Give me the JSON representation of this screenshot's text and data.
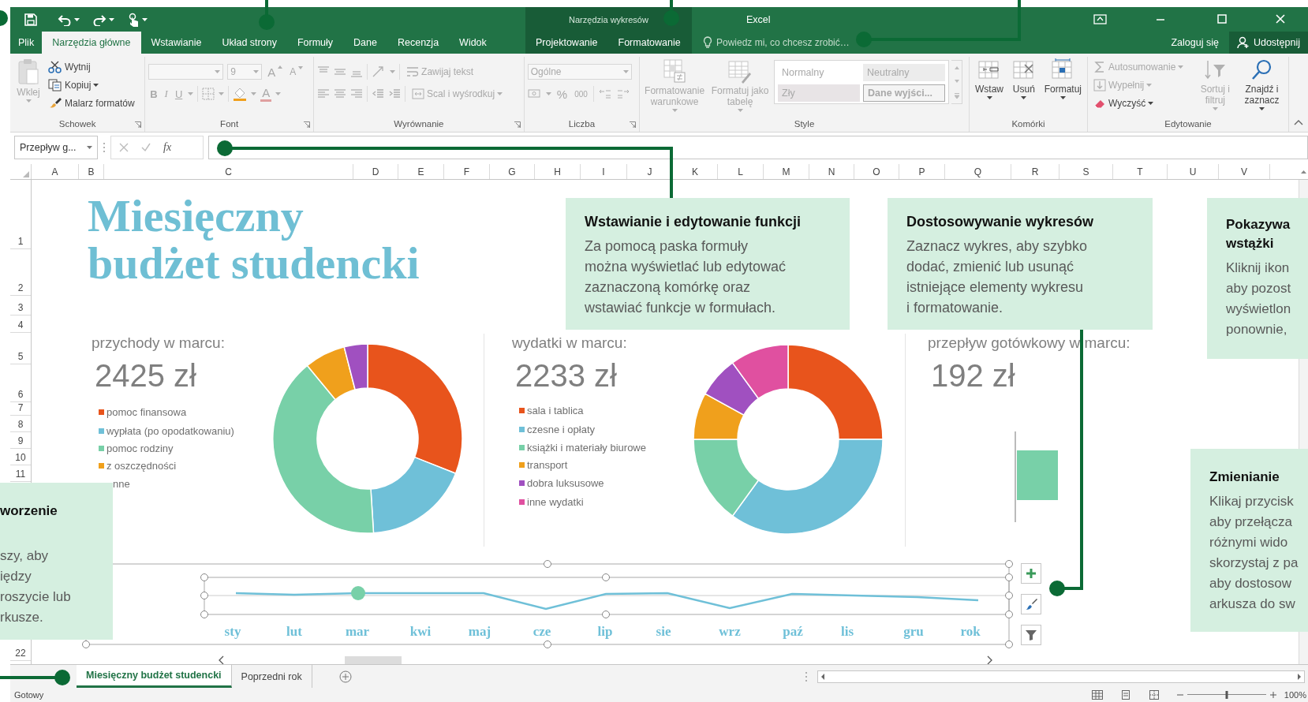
{
  "title_bar": {
    "context_title": "Narzędzia wykresów",
    "title": "Excel"
  },
  "tabs": [
    {
      "label": "Plik",
      "kind": "file",
      "selected": false
    },
    {
      "label": "Narzędzia główne",
      "kind": "standard",
      "selected": true
    },
    {
      "label": "Wstawianie",
      "kind": "standard",
      "selected": false
    },
    {
      "label": "Układ strony",
      "kind": "standard",
      "selected": false
    },
    {
      "label": "Formuły",
      "kind": "standard",
      "selected": false
    },
    {
      "label": "Dane",
      "kind": "standard",
      "selected": false
    },
    {
      "label": "Recenzja",
      "kind": "standard",
      "selected": false
    },
    {
      "label": "Widok",
      "kind": "standard",
      "selected": false
    },
    {
      "label": "Projektowanie",
      "kind": "contextual",
      "selected": false
    },
    {
      "label": "Formatowanie",
      "kind": "contextual",
      "selected": false
    }
  ],
  "tell_me": {
    "placeholder": "Powiedz mi, co chcesz zrobić…"
  },
  "account": {
    "sign_in": "Zaloguj się",
    "share": "Udostępnij"
  },
  "ribbon": {
    "groups": [
      {
        "kind": "clipboard",
        "label": "Schowek",
        "launcher": true,
        "buttons": [
          {
            "label": "Wklej",
            "disabled": true
          },
          {
            "label": "Wytnij",
            "disabled": false
          },
          {
            "label": "Kopiuj",
            "disabled": false
          },
          {
            "label": "Malarz formatów",
            "disabled": false
          }
        ]
      },
      {
        "kind": "font",
        "label": "Font",
        "launcher": true,
        "disabled": true,
        "size_field": {
          "value": "9"
        },
        "buttons": [
          {
            "label": "A"
          },
          {
            "label": "A"
          },
          {
            "label": "B"
          },
          {
            "label": "I"
          },
          {
            "label": "U"
          },
          {
            "label": "A"
          }
        ]
      },
      {
        "kind": "alignment",
        "label": "Wyrównanie",
        "launcher": true,
        "disabled": true,
        "buttons": [
          {
            "label": "Zawijaj tekst"
          },
          {
            "label": "Scal i wyśrodkuj"
          }
        ]
      },
      {
        "kind": "number",
        "label": "Liczba",
        "launcher": true,
        "disabled": true,
        "format_field": {
          "value": "Ogólne"
        },
        "buttons": [
          {
            "label": "%"
          },
          {
            "label": "000"
          }
        ]
      },
      {
        "kind": "styles",
        "label": "Style",
        "launcher": false,
        "buttons": [
          {
            "label": "Formatowanie warunkowe",
            "disabled": true
          },
          {
            "label": "Formatuj jako tabelę",
            "disabled": true
          }
        ],
        "styles": [
          {
            "label": "Normalny",
            "kind": "normal"
          },
          {
            "label": "Neutralny",
            "kind": "neutral"
          },
          {
            "label": "Zły",
            "kind": "bad"
          },
          {
            "label": "Dane wyjści...",
            "kind": "output"
          }
        ]
      },
      {
        "kind": "cells",
        "label": "Komórki",
        "launcher": false,
        "buttons": [
          {
            "label": "Wstaw",
            "disabled": false
          },
          {
            "label": "Usuń",
            "disabled": false
          },
          {
            "label": "Formatuj",
            "disabled": false
          }
        ]
      },
      {
        "kind": "editing",
        "label": "Edytowanie",
        "launcher": false,
        "buttons": [
          {
            "label": "Autosumowanie",
            "disabled": true
          },
          {
            "label": "Wypełnij",
            "disabled": true
          },
          {
            "label": "Wyczyść",
            "disabled": false
          },
          {
            "label": "Sortuj i filtruj",
            "disabled": true
          },
          {
            "label": "Znajdź i zaznacz",
            "disabled": false
          }
        ]
      }
    ]
  },
  "formula_bar": {
    "name_box": "Przepływ g...",
    "function_label": "fx"
  },
  "columns": [
    "A",
    "B",
    "C",
    "D",
    "E",
    "F",
    "G",
    "H",
    "I",
    "J",
    "K",
    "L",
    "M",
    "N",
    "O",
    "P",
    "Q",
    "R",
    "S",
    "T",
    "U",
    "V"
  ],
  "rows": [
    "1",
    "2",
    "3",
    "4",
    "5",
    "6",
    "7",
    "8",
    "9",
    "10",
    "11",
    "22"
  ],
  "sheet": {
    "title": "Miesięczny\nbudżet studencki",
    "summaries": [
      {
        "heading": "przychody w marcu:",
        "amount": "2425 zł",
        "legend": [
          {
            "label": "pomoc finansowa",
            "color": "#e8541c"
          },
          {
            "label": "wypłata (po opodatkowaniu)",
            "color": "#6fc0d8"
          },
          {
            "label": "pomoc rodziny",
            "color": "#78d0a8"
          },
          {
            "label": "z oszczędności",
            "color": "#f0a01c"
          },
          {
            "label": "nne"
          }
        ]
      },
      {
        "heading": "wydatki w marcu:",
        "amount": "2233 zł",
        "legend": [
          {
            "label": "sala i tablica",
            "color": "#e8541c"
          },
          {
            "label": "czesne i opłaty",
            "color": "#6fc0d8"
          },
          {
            "label": "książki i materiały biurowe",
            "color": "#78d0a8"
          },
          {
            "label": "transport",
            "color": "#f0a01c"
          },
          {
            "label": "dobra luksusowe",
            "color": "#a050c0"
          },
          {
            "label": "inne wydatki",
            "color": "#e050a0"
          }
        ]
      },
      {
        "heading": "przepływ gotówkowy w marcu:",
        "amount": "192 zł"
      }
    ],
    "trend_chart": {
      "months": [
        "sty",
        "lut",
        "mar",
        "kwi",
        "maj",
        "cze",
        "lip",
        "sie",
        "wrz",
        "paź",
        "lis",
        "gru",
        "rok"
      ]
    }
  },
  "callouts": [
    {
      "heading": "Wstawianie i edytowanie funkcji",
      "body": "Za pomocą paska formuły\nmożna wyświetlać lub edytować\nzaznaczoną komórkę oraz\nwstawiać funkcje w formułach."
    },
    {
      "heading": "Dostosowywanie wykresów",
      "body": "Zaznacz wykres, aby szybko\ndodać, zmienić lub usunąć\nistniejące elementy wykresu\ni formatowanie."
    },
    {
      "heading": "Pokazywa\nwstążki",
      "body": "Kliknij ikon\naby pozost\nwyświetlon\nponownie,"
    },
    {
      "heading": "Zmienianie",
      "body": "Klikaj przycisk\naby przełącza\nróżnymi wido\nskorzystaj z pa\naby dostosow\narkusza do sw"
    },
    {
      "heading": "worzenie",
      "body": "szy, aby\niędzy\nroszycie lub\nrkusze."
    }
  ],
  "sheet_tabs": [
    {
      "label": "Miesięczny budżet studencki",
      "selected": true
    },
    {
      "label": "Poprzedni rok",
      "selected": false
    }
  ],
  "status_bar": {
    "text": "Gotowy",
    "zoom": {
      "level": 0.5,
      "reading": "100%"
    }
  }
}
